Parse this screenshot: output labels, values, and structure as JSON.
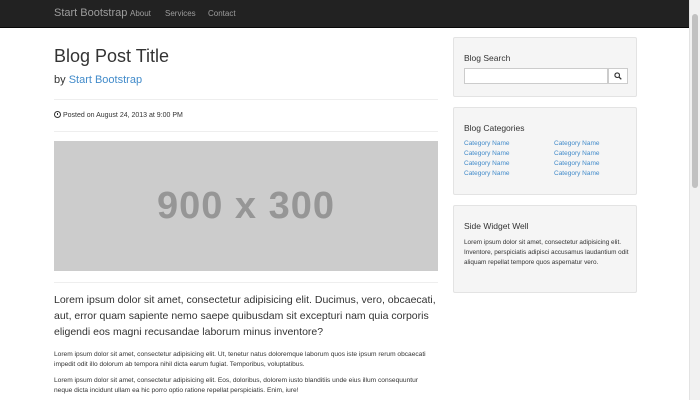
{
  "navbar": {
    "brand": "Start Bootstrap",
    "links": [
      "About",
      "Services",
      "Contact"
    ]
  },
  "post": {
    "title": "Blog Post Title",
    "by_prefix": "by",
    "author": "Start Bootstrap",
    "posted": "Posted on August 24, 2013 at 9:00 PM",
    "image_text": "900 x 300",
    "lead": "Lorem ipsum dolor sit amet, consectetur adipisicing elit. Ducimus, vero, obcaecati, aut, error quam sapiente nemo saepe quibusdam sit excepturi nam quia corporis eligendi eos magni recusandae laborum minus inventore?",
    "paragraphs": [
      "Lorem ipsum dolor sit amet, consectetur adipisicing elit. Ut, tenetur natus doloremque laborum quos iste ipsum rerum obcaecati impedit odit illo dolorum ab tempora nihil dicta earum fugiat. Temporibus, voluptatibus.",
      "Lorem ipsum dolor sit amet, consectetur adipisicing elit. Eos, doloribus, dolorem iusto blanditiis unde eius illum consequuntur neque dicta incidunt ullam ea hic porro optio ratione repellat perspiciatis. Enim, iure!"
    ]
  },
  "sidebar": {
    "search": {
      "title": "Blog Search",
      "value": "",
      "placeholder": ""
    },
    "categories": {
      "title": "Blog Categories",
      "items": [
        "Category Name",
        "Category Name",
        "Category Name",
        "Category Name",
        "Category Name",
        "Category Name",
        "Category Name",
        "Category Name"
      ]
    },
    "widget": {
      "title": "Side Widget Well",
      "text": "Lorem ipsum dolor sit amet, consectetur adipisicing elit. Inventore, perspiciatis adipisci accusamus laudantium odit aliquam repellat tempore quos aspernatur vero."
    }
  },
  "colors": {
    "navbar": "#222222",
    "link": "#428bca",
    "well": "#f5f5f5",
    "placeholder": "#cccccc"
  }
}
